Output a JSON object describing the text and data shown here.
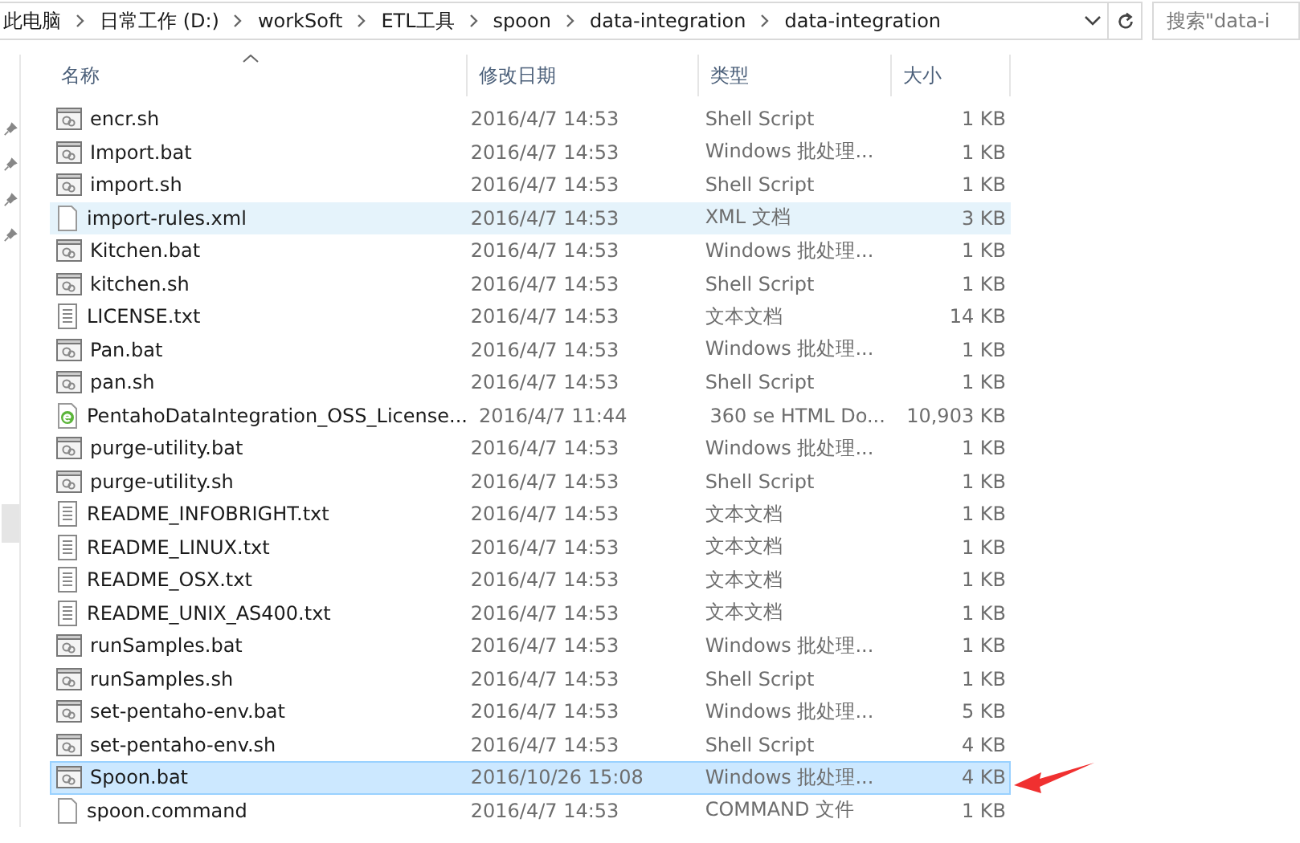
{
  "address_bar": {
    "crumbs": [
      "此电脑",
      "日常工作 (D:)",
      "workSoft",
      "ETL工具",
      "spoon",
      "data-integration",
      "data-integration"
    ]
  },
  "search": {
    "placeholder": "搜索\"data-i"
  },
  "columns": [
    "名称",
    "修改日期",
    "类型",
    "大小"
  ],
  "files": [
    {
      "name": "encr.sh",
      "date": "2016/4/7 14:53",
      "type": "Shell Script",
      "size": "1 KB",
      "kind": "script",
      "selected": false,
      "hovered": false
    },
    {
      "name": "Import.bat",
      "date": "2016/4/7 14:53",
      "type": "Windows 批处理...",
      "size": "1 KB",
      "kind": "script",
      "selected": false,
      "hovered": false
    },
    {
      "name": "import.sh",
      "date": "2016/4/7 14:53",
      "type": "Shell Script",
      "size": "1 KB",
      "kind": "script",
      "selected": false,
      "hovered": false
    },
    {
      "name": "import-rules.xml",
      "date": "2016/4/7 14:53",
      "type": "XML 文档",
      "size": "3 KB",
      "kind": "blank",
      "selected": false,
      "hovered": true
    },
    {
      "name": "Kitchen.bat",
      "date": "2016/4/7 14:53",
      "type": "Windows 批处理...",
      "size": "1 KB",
      "kind": "script",
      "selected": false,
      "hovered": false
    },
    {
      "name": "kitchen.sh",
      "date": "2016/4/7 14:53",
      "type": "Shell Script",
      "size": "1 KB",
      "kind": "script",
      "selected": false,
      "hovered": false
    },
    {
      "name": "LICENSE.txt",
      "date": "2016/4/7 14:53",
      "type": "文本文档",
      "size": "14 KB",
      "kind": "text",
      "selected": false,
      "hovered": false
    },
    {
      "name": "Pan.bat",
      "date": "2016/4/7 14:53",
      "type": "Windows 批处理...",
      "size": "1 KB",
      "kind": "script",
      "selected": false,
      "hovered": false
    },
    {
      "name": "pan.sh",
      "date": "2016/4/7 14:53",
      "type": "Shell Script",
      "size": "1 KB",
      "kind": "script",
      "selected": false,
      "hovered": false
    },
    {
      "name": "PentahoDataIntegration_OSS_License...",
      "date": "2016/4/7 11:44",
      "type": "360 se HTML Do...",
      "size": "10,903 KB",
      "kind": "html",
      "selected": false,
      "hovered": false
    },
    {
      "name": "purge-utility.bat",
      "date": "2016/4/7 14:53",
      "type": "Windows 批处理...",
      "size": "1 KB",
      "kind": "script",
      "selected": false,
      "hovered": false
    },
    {
      "name": "purge-utility.sh",
      "date": "2016/4/7 14:53",
      "type": "Shell Script",
      "size": "1 KB",
      "kind": "script",
      "selected": false,
      "hovered": false
    },
    {
      "name": "README_INFOBRIGHT.txt",
      "date": "2016/4/7 14:53",
      "type": "文本文档",
      "size": "1 KB",
      "kind": "text",
      "selected": false,
      "hovered": false
    },
    {
      "name": "README_LINUX.txt",
      "date": "2016/4/7 14:53",
      "type": "文本文档",
      "size": "1 KB",
      "kind": "text",
      "selected": false,
      "hovered": false
    },
    {
      "name": "README_OSX.txt",
      "date": "2016/4/7 14:53",
      "type": "文本文档",
      "size": "1 KB",
      "kind": "text",
      "selected": false,
      "hovered": false
    },
    {
      "name": "README_UNIX_AS400.txt",
      "date": "2016/4/7 14:53",
      "type": "文本文档",
      "size": "1 KB",
      "kind": "text",
      "selected": false,
      "hovered": false
    },
    {
      "name": "runSamples.bat",
      "date": "2016/4/7 14:53",
      "type": "Windows 批处理...",
      "size": "1 KB",
      "kind": "script",
      "selected": false,
      "hovered": false
    },
    {
      "name": "runSamples.sh",
      "date": "2016/4/7 14:53",
      "type": "Shell Script",
      "size": "1 KB",
      "kind": "script",
      "selected": false,
      "hovered": false
    },
    {
      "name": "set-pentaho-env.bat",
      "date": "2016/4/7 14:53",
      "type": "Windows 批处理...",
      "size": "5 KB",
      "kind": "script",
      "selected": false,
      "hovered": false
    },
    {
      "name": "set-pentaho-env.sh",
      "date": "2016/4/7 14:53",
      "type": "Shell Script",
      "size": "4 KB",
      "kind": "script",
      "selected": false,
      "hovered": false
    },
    {
      "name": "Spoon.bat",
      "date": "2016/10/26 15:08",
      "type": "Windows 批处理...",
      "size": "4 KB",
      "kind": "script",
      "selected": true,
      "hovered": false
    },
    {
      "name": "spoon.command",
      "date": "2016/4/7 14:53",
      "type": "COMMAND 文件",
      "size": "1 KB",
      "kind": "blank",
      "selected": false,
      "hovered": false
    }
  ]
}
